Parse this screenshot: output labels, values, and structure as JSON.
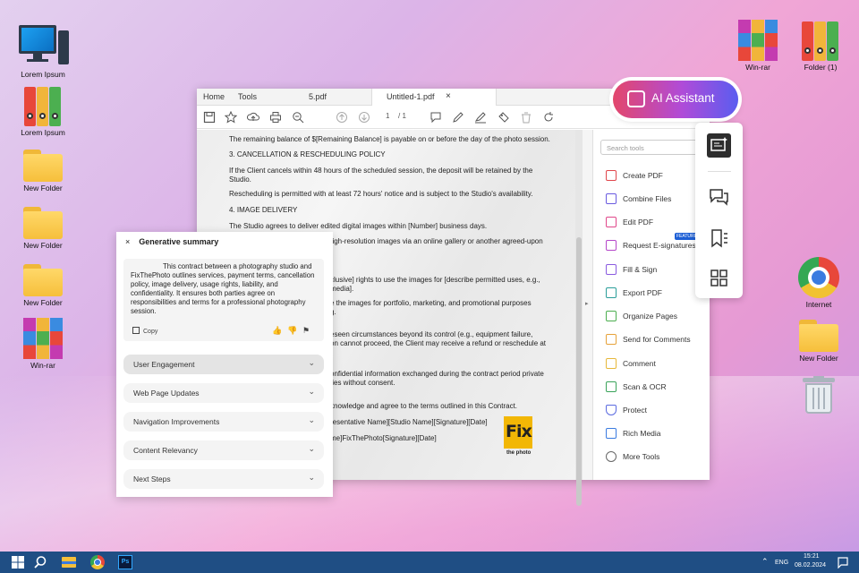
{
  "desktop": {
    "icons_left": [
      {
        "label": "Lorem Ipsum",
        "kind": "computer-icon"
      },
      {
        "label": "Lorem Ipsum",
        "kind": "binders-icon"
      },
      {
        "label": "New Folder",
        "kind": "folder-icon"
      },
      {
        "label": "New Folder",
        "kind": "folder-icon"
      },
      {
        "label": "New Folder",
        "kind": "folder-icon"
      },
      {
        "label": "Win-rar",
        "kind": "winrar-icon"
      }
    ],
    "icons_right": [
      {
        "label": "Win-rar",
        "kind": "winrar-icon"
      },
      {
        "label": "Folder (1)",
        "kind": "binders-icon"
      },
      {
        "label": "Internet",
        "kind": "chrome-icon"
      },
      {
        "label": "New Folder",
        "kind": "folder-icon"
      },
      {
        "label": "",
        "kind": "trash-icon"
      }
    ]
  },
  "window": {
    "tabs": {
      "home": "Home",
      "tools": "Tools",
      "file1": "5.pdf",
      "file2": "Untitled-1.pdf",
      "close": "×"
    },
    "page_current": "1",
    "page_total": "/ 1",
    "document_lines": [
      "The remaining balance of $[Remaining Balance] is payable on or before the day of the photo session.",
      "3. CANCELLATION & RESCHEDULING POLICY",
      "If the Client cancels within 48 hours of the scheduled session, the deposit will be retained by the",
      "Studio.",
      "Rescheduling is permitted with at least 72 hours' notice and is subject to the Studio's availability.",
      "4. IMAGE DELIVERY",
      "The Studio agrees to deliver edited digital images within [Number] business days.",
      "high-resolution images via an online gallery or another agreed-upon",
      "clusive] rights to use the images for [describe permitted uses, e.g.,",
      "media].",
      "e the images for portfolio, marketing, and promotional purposes",
      "g.",
      "eseen circumstances beyond its control (e.g., equipment failure,",
      "on cannot proceed, the Client may receive a refund or reschedule at",
      "onfidential information exchanged during the contract period private",
      "ties without consent.",
      "knowledge and agree to the terms outlined in this Contract.",
      "resentative Name][Studio Name][Signature][Date]",
      "me]FixThePhoto[Signature][Date]"
    ],
    "logo": {
      "big": "Fix",
      "small": "the photo"
    },
    "search_placeholder": "Search tools",
    "tools": [
      {
        "label": "Create PDF",
        "color": "#e0474c"
      },
      {
        "label": "Combine Files",
        "color": "#6a5be0"
      },
      {
        "label": "Edit PDF",
        "color": "#e0478a"
      },
      {
        "label": "Request E-signatures",
        "color": "#b547c9"
      },
      {
        "label": "Fill & Sign",
        "color": "#8a5be0"
      },
      {
        "label": "Export PDF",
        "color": "#2b9e9a"
      },
      {
        "label": "Organize Pages",
        "color": "#4cae4f"
      },
      {
        "label": "Send for Comments",
        "color": "#e6a23a"
      },
      {
        "label": "Comment",
        "color": "#e6b83a"
      },
      {
        "label": "Scan & OCR",
        "color": "#3aa35a"
      },
      {
        "label": "Protect",
        "color": "#5b6be0"
      },
      {
        "label": "Rich Media",
        "color": "#3a7be0"
      },
      {
        "label": "More Tools",
        "color": "#666666"
      }
    ],
    "featured_badge": "FEATURED"
  },
  "summary": {
    "close": "×",
    "title": "Generative summary",
    "text": "This contract between a photography studio and FixThePhoto outlines services, payment terms, cancellation policy, image delivery, usage rights, liability, and confidentiality. It ensures both parties agree on responsibilities and terms for a professional photography session.",
    "copy_label": "Copy",
    "sections": [
      "User Engagement",
      "Web Page Updates",
      "Navigation Improvements",
      "Content Relevancy",
      "Next Steps"
    ]
  },
  "ai_assistant": {
    "label": "AI Assistant"
  },
  "taskbar": {
    "lang": "ENG",
    "time": "15:21",
    "date": "08.02.2024"
  }
}
